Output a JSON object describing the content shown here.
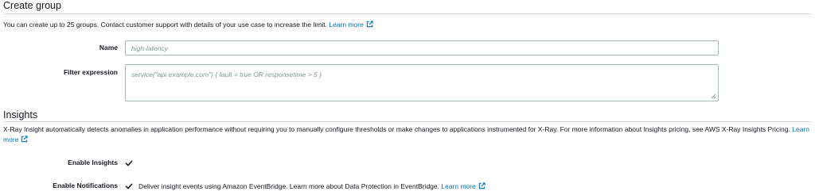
{
  "create_group": {
    "title": "Create group",
    "description": "You can create up to 25 groups. Contact customer support with details of your use case to increase the limit.",
    "learn_more": "Learn more",
    "name_label": "Name",
    "name_placeholder": "high-latency",
    "filter_label": "Filter expression",
    "filter_placeholder": "service(\"api.example.com\") { fault = true OR responsetime > 5 }"
  },
  "insights": {
    "title": "Insights",
    "description": "X-Ray Insight automatically detects anomalies in application performance without requiring you to manually configure thresholds or make changes to applications instrumented for X-Ray. For more information about Insights pricing, see AWS X-Ray Insights Pricing.",
    "learn_more": "Learn more",
    "enable_insights_label": "Enable Insights",
    "enable_insights_checked": true,
    "enable_notifications_label": "Enable Notifications",
    "enable_notifications_checked": true,
    "notifications_text": "Deliver insight events using Amazon EventBridge. Learn more about Data Protection in EventBridge.",
    "notifications_learn_more": "Learn more"
  },
  "colors": {
    "link": "#0073bb",
    "divider": "#d5dbdb",
    "input_border": "#aab7b8",
    "check": "#16191f"
  },
  "icons": {
    "external_link": "external-link-icon",
    "check": "checkmark-icon",
    "resize": "resize-grip-icon"
  }
}
